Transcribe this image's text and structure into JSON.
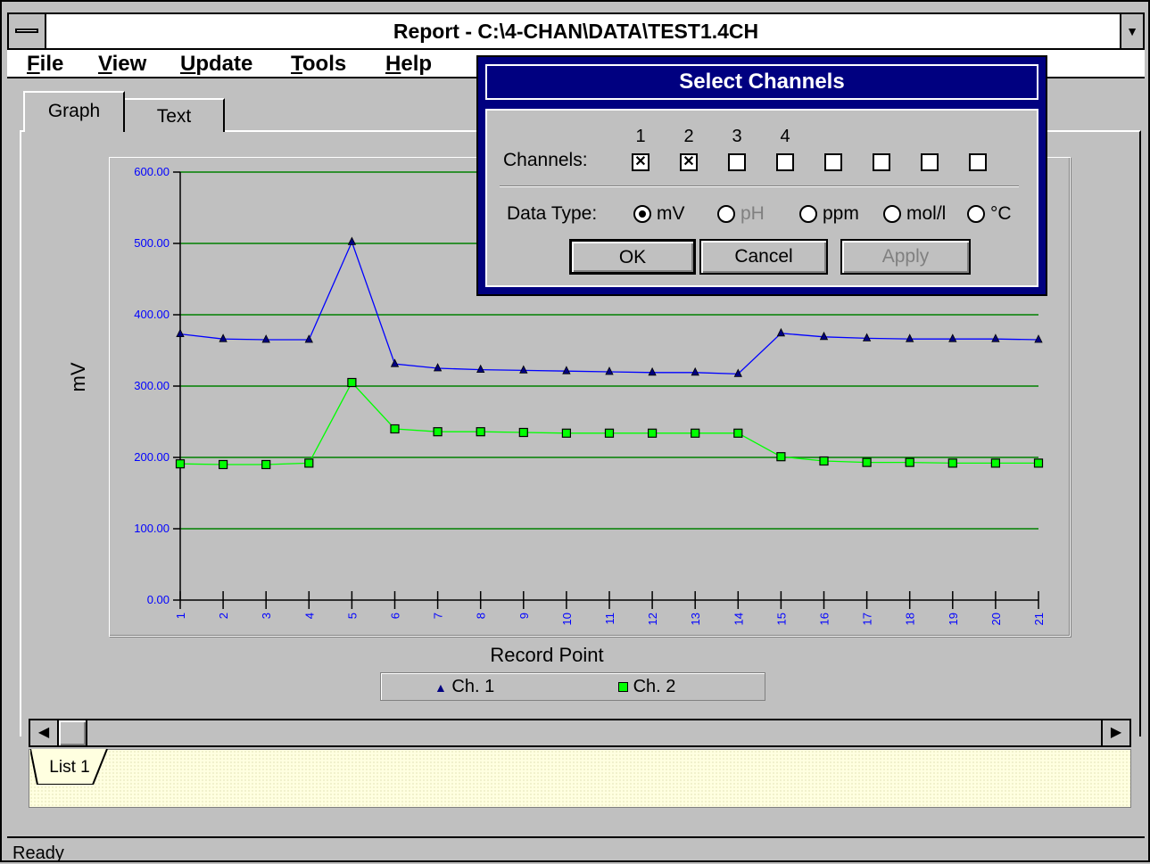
{
  "window": {
    "title": "Report - C:\\4-CHAN\\DATA\\TEST1.4CH",
    "control_menu_icon": "minus-bar-icon",
    "dropdown_icon": "triangle-down-icon"
  },
  "menu": [
    "File",
    "View",
    "Update",
    "Tools",
    "Help"
  ],
  "tabs": [
    "Graph",
    "Text"
  ],
  "chart": {
    "ylabel": "mV",
    "xlabel": "Record Point",
    "legend": [
      "Ch. 1",
      "Ch. 2"
    ]
  },
  "chart_data": {
    "type": "line",
    "x": [
      1,
      2,
      3,
      4,
      5,
      6,
      7,
      8,
      9,
      10,
      11,
      12,
      13,
      14,
      15,
      16,
      17,
      18,
      19,
      20,
      21
    ],
    "ylim": [
      0,
      600
    ],
    "yticks": [
      "0.00",
      "100.00",
      "200.00",
      "300.00",
      "400.00",
      "500.00",
      "600.00"
    ],
    "xlabel": "Record Point",
    "ylabel": "mV",
    "grid": true,
    "legend_position": "bottom",
    "series": [
      {
        "name": "Ch. 1",
        "marker": "triangle",
        "color": "#0000ff",
        "values": [
          373,
          366,
          365,
          365,
          502,
          331,
          325,
          323,
          322,
          321,
          320,
          319,
          319,
          317,
          374,
          369,
          367,
          366,
          366,
          366,
          365
        ]
      },
      {
        "name": "Ch. 2",
        "marker": "square",
        "color": "#00ff00",
        "values": [
          191,
          190,
          190,
          192,
          305,
          240,
          236,
          236,
          235,
          234,
          234,
          234,
          234,
          234,
          201,
          195,
          193,
          193,
          192,
          192,
          192
        ]
      }
    ]
  },
  "scrollbar": {
    "left_icon": "arrow-left-icon",
    "right_icon": "arrow-right-icon"
  },
  "list": {
    "tab_label": "List 1"
  },
  "status": {
    "text": "Ready"
  },
  "dialog": {
    "title": "Select Channels",
    "channels_label": "Channels:",
    "channel_numbers": [
      "1",
      "2",
      "3",
      "4"
    ],
    "channel_checks": [
      true,
      true,
      false,
      false,
      false,
      false,
      false,
      false
    ],
    "datatype_label": "Data Type:",
    "datatypes": [
      {
        "label": "mV",
        "selected": true,
        "enabled": true
      },
      {
        "label": "pH",
        "selected": false,
        "enabled": false
      },
      {
        "label": "ppm",
        "selected": false,
        "enabled": true
      },
      {
        "label": "mol/l",
        "selected": false,
        "enabled": true
      },
      {
        "label": "°C",
        "selected": false,
        "enabled": true
      }
    ],
    "buttons": {
      "ok": "OK",
      "cancel": "Cancel",
      "apply": "Apply"
    }
  }
}
